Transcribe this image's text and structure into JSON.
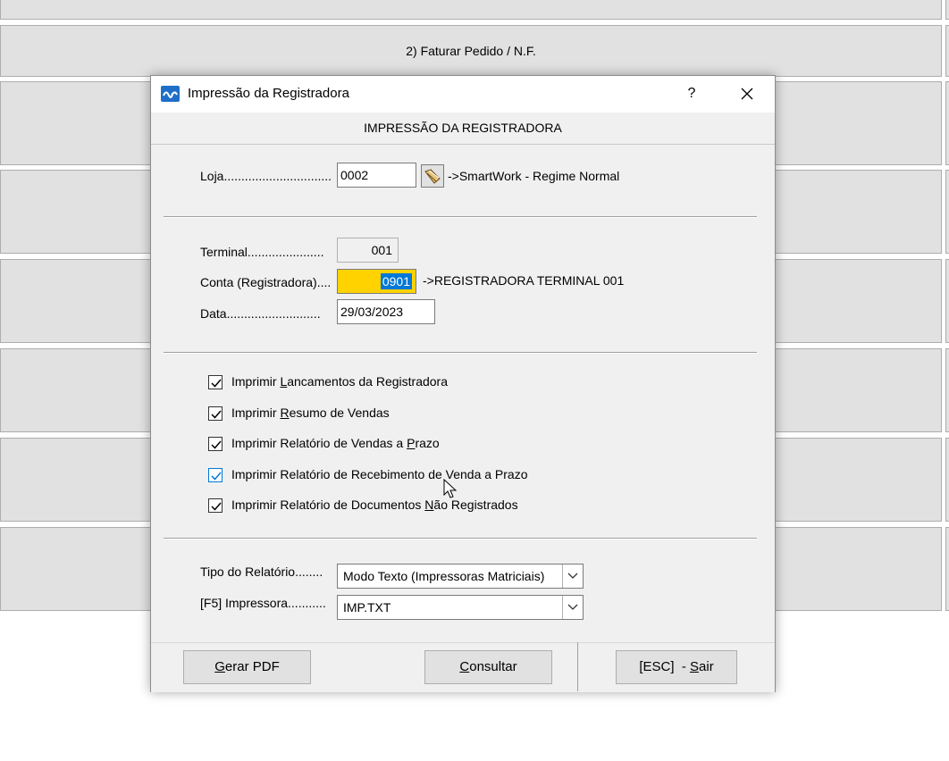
{
  "background": {
    "menu_label": "2) Faturar Pedido / N.F."
  },
  "dialog": {
    "title": "Impressão da Registradora",
    "help_label": "?",
    "close_label": "✕",
    "heading": "IMPRESSÃO DA REGISTRADORA",
    "loja": {
      "label": "Loja...............................",
      "value": "0002",
      "description": "->SmartWork - Regime Normal"
    },
    "terminal": {
      "label": "Terminal......................",
      "value": "001"
    },
    "conta": {
      "label": "Conta (Registradora)....",
      "value": "0901",
      "description": "->REGISTRADORA TERMINAL 001"
    },
    "data": {
      "label": "Data...........................",
      "value": "29/03/2023"
    },
    "checkboxes": [
      {
        "pre": "Imprimir ",
        "mn": "L",
        "post": "ancamentos da Registradora",
        "checked": true
      },
      {
        "pre": "Imprimir ",
        "mn": "R",
        "post": "esumo de Vendas",
        "checked": true
      },
      {
        "pre": "Imprimir Relatório de Vendas a ",
        "mn": "P",
        "post": "razo",
        "checked": true
      },
      {
        "pre": "Imprimir Relatório de Recebimento de Venda a Prazo",
        "mn": "",
        "post": "",
        "checked": true
      },
      {
        "pre": "Imprimir Relatório de Documentos ",
        "mn": "N",
        "post": "ão Registrados",
        "checked": true
      }
    ],
    "tipo_relatorio": {
      "label": "Tipo do Relatório........",
      "value": "Modo Texto (Impressoras Matriciais)"
    },
    "impressora": {
      "label": "[F5] Impressora...........",
      "value": "IMP.TXT"
    },
    "buttons": {
      "gerar_pdf": {
        "mn": "G",
        "rest": "erar PDF"
      },
      "consultar": {
        "mn": "C",
        "rest": "onsultar"
      },
      "sair": {
        "pre": "[ESC]  - ",
        "mn": "S",
        "rest": "air"
      }
    }
  },
  "colors": {
    "highlight_field": "#ffd200",
    "selection": "#0078d7",
    "app_icon": "#1f6fc9"
  }
}
